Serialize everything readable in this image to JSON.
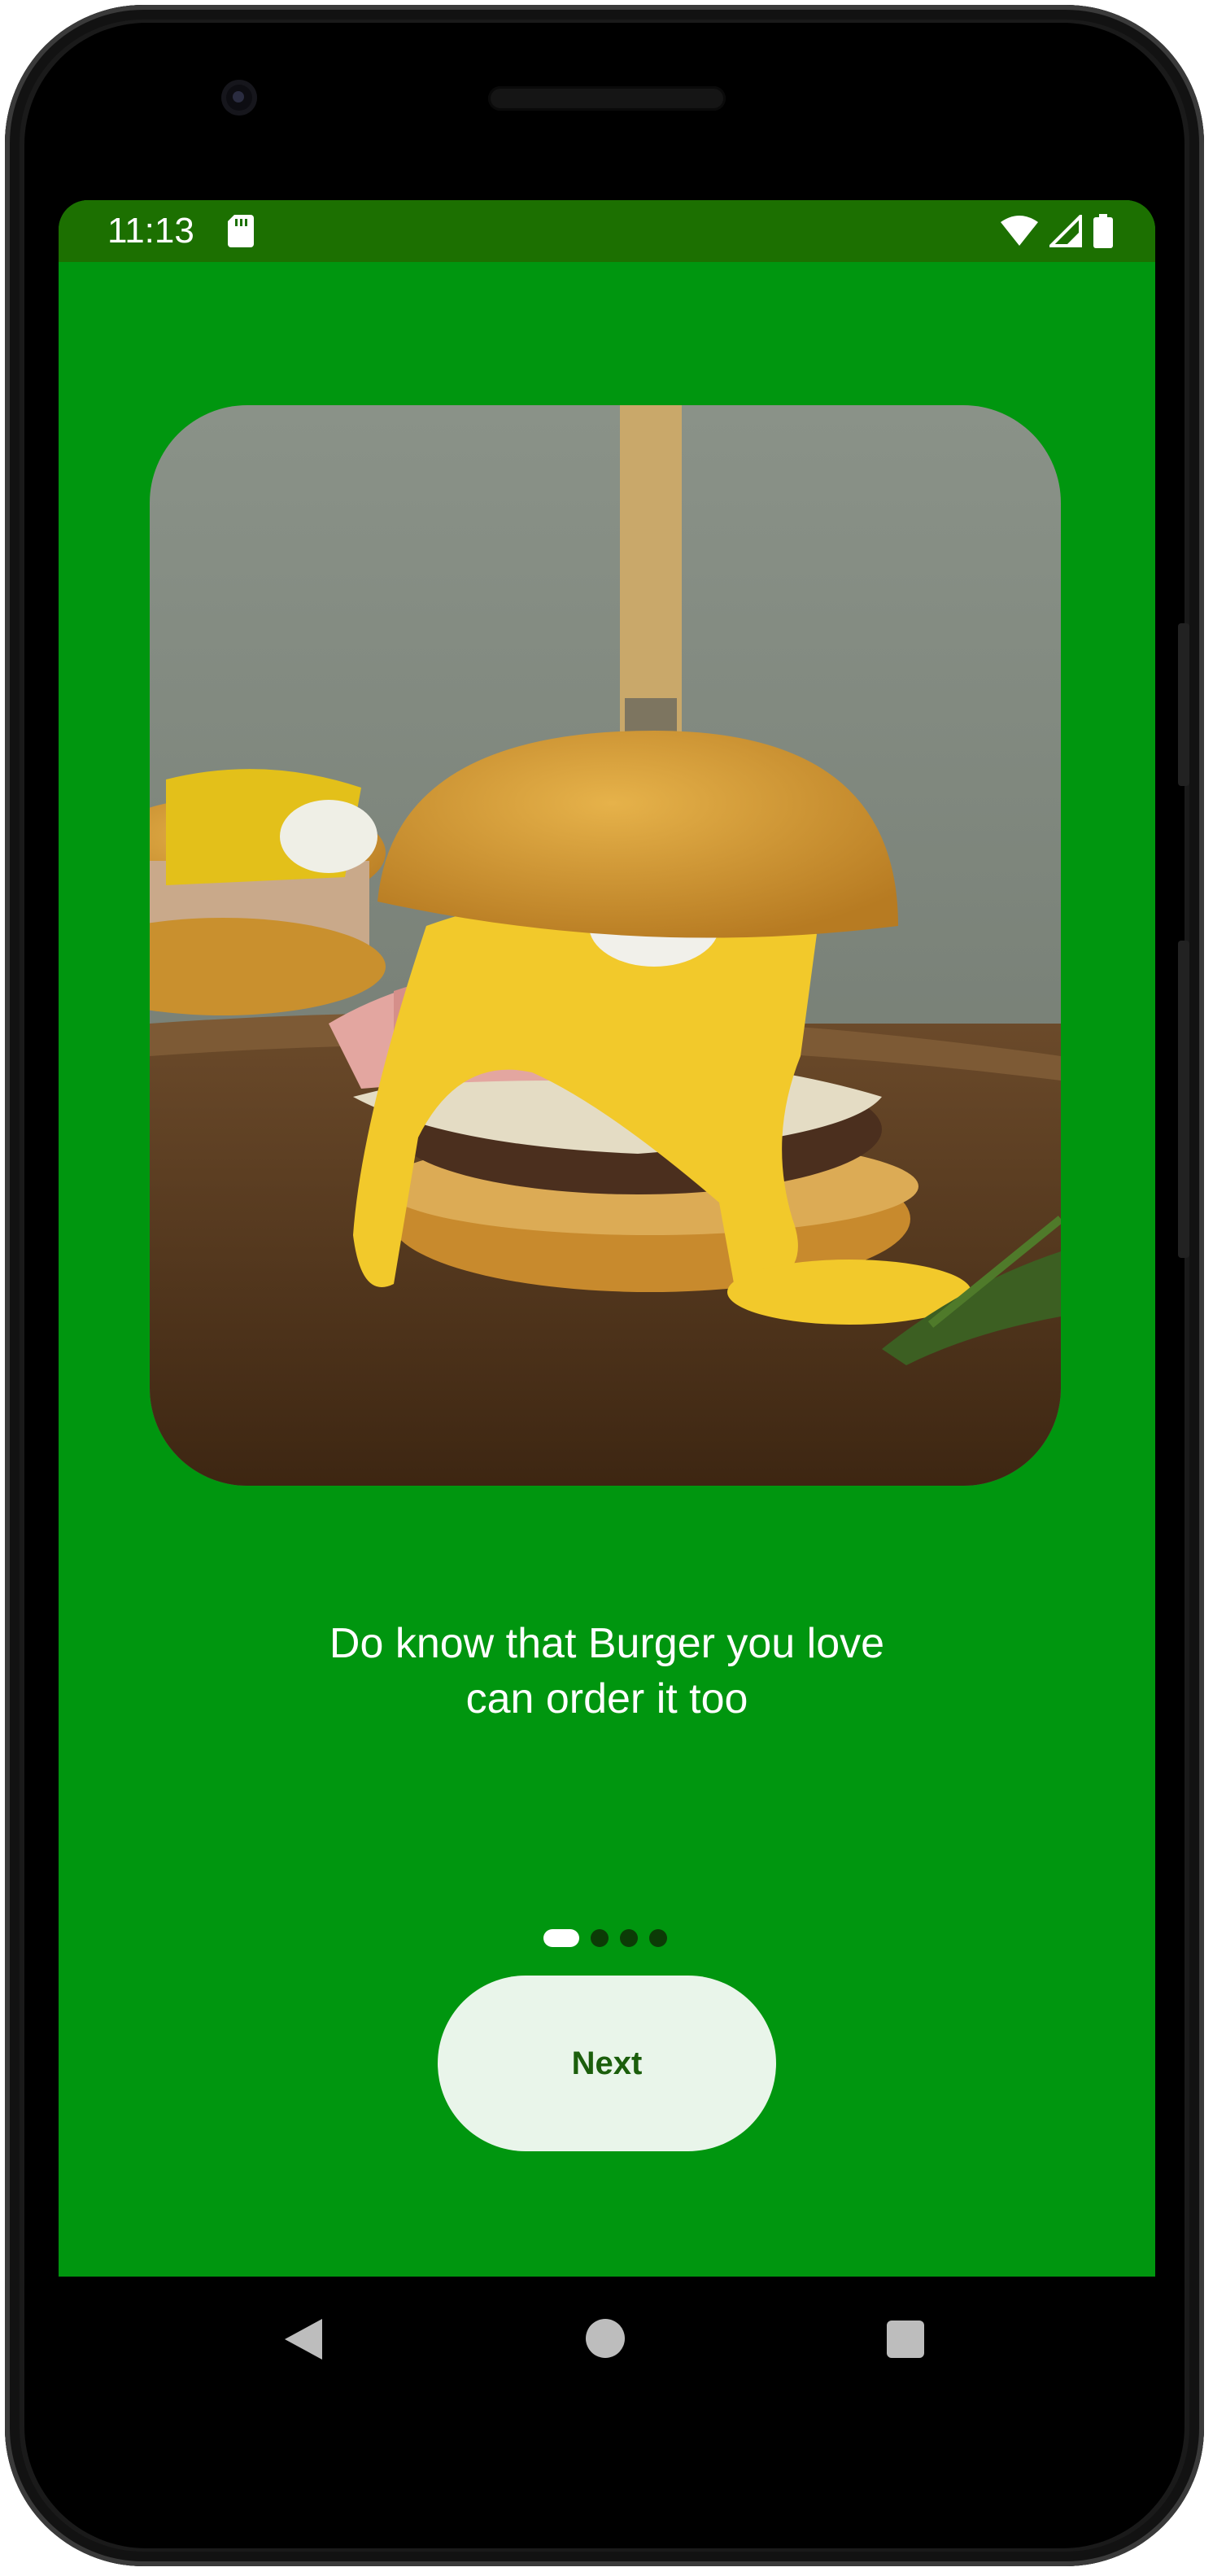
{
  "status_bar": {
    "time": "11:13",
    "icons": [
      "sd-card-icon",
      "wifi-icon",
      "cellular-signal-icon",
      "battery-icon"
    ],
    "background": "#1c7001"
  },
  "onboarding": {
    "background": "#00960f",
    "hero_image": "burger-photo",
    "caption": "Do know that Burger you love\ncan order it too",
    "page_indicator": {
      "total": 4,
      "current": 1
    },
    "next_label": "Next"
  },
  "navigation_bar": {
    "buttons": [
      "back-icon",
      "home-icon",
      "recents-icon"
    ]
  }
}
